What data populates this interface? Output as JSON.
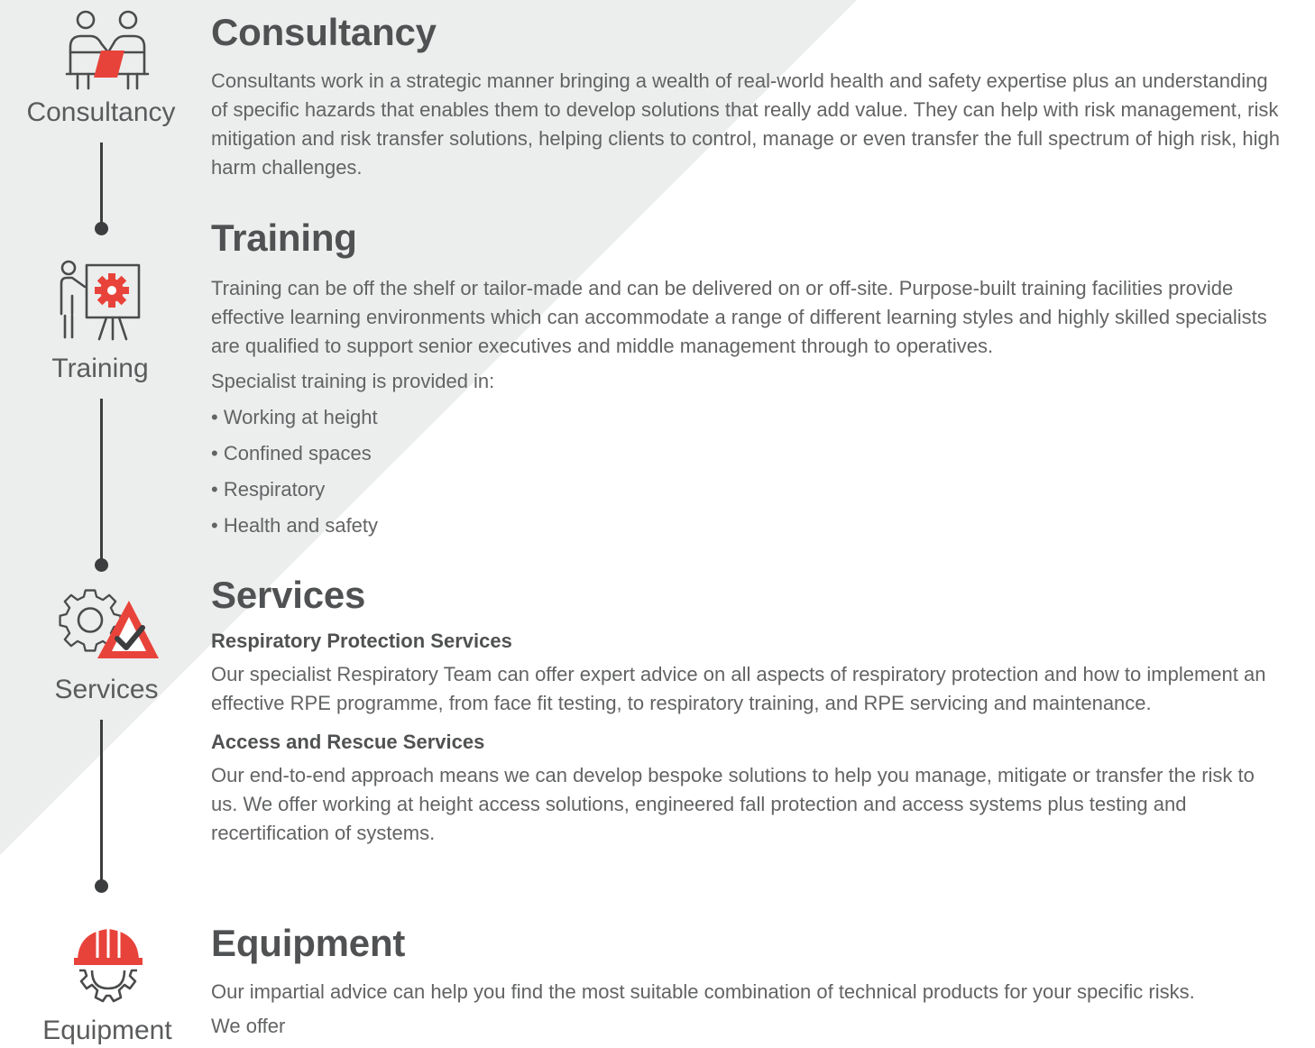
{
  "colors": {
    "accent": "#e8433a",
    "text": "#5f6061",
    "heading": "#505152",
    "background_band": "#eceded"
  },
  "sidebar": {
    "steps": [
      {
        "label": "Consultancy",
        "icon": "consultancy-meeting-icon"
      },
      {
        "label": "Training",
        "icon": "training-presentation-icon"
      },
      {
        "label": "Services",
        "icon": "services-gear-warning-icon"
      },
      {
        "label": "Equipment",
        "icon": "equipment-hardhat-gear-icon"
      }
    ]
  },
  "sections": {
    "consultancy": {
      "title": "Consultancy",
      "body": "Consultants work in a strategic manner bringing a wealth of real-world health and safety expertise plus an understanding of specific hazards that enables them to develop solutions that really add value. They can help with risk management, risk mitigation and risk transfer solutions, helping clients to control, manage or even transfer the full spectrum of high risk, high harm challenges."
    },
    "training": {
      "title": "Training",
      "body": "Training can be off the shelf or tailor-made and can be delivered on or off-site. Purpose-built training facilities provide effective learning environments which can accommodate a range of different learning styles and highly skilled specialists are qualified to support senior executives and middle management through to operatives.",
      "intro": "Specialist training is provided in:",
      "bullets": [
        "• Working at height",
        "• Confined spaces",
        "• Respiratory",
        "• Health and safety"
      ]
    },
    "services": {
      "title": "Services",
      "sub1": "Respiratory Protection Services",
      "body1": "Our specialist Respiratory Team can offer expert advice on all aspects of respiratory protection and how to implement an effective RPE programme, from face fit testing, to respiratory training, and RPE servicing and maintenance.",
      "sub2": "Access and Rescue Services",
      "body2": "Our end-to-end approach means we can develop bespoke solutions to help you manage, mitigate or transfer the risk to us. We offer working at height access solutions, engineered fall protection and access systems plus testing and recertification of systems."
    },
    "equipment": {
      "title": "Equipment",
      "body": "Our impartial advice can help you find the most suitable combination of technical products for your specific risks.",
      "intro": "We offer"
    }
  }
}
